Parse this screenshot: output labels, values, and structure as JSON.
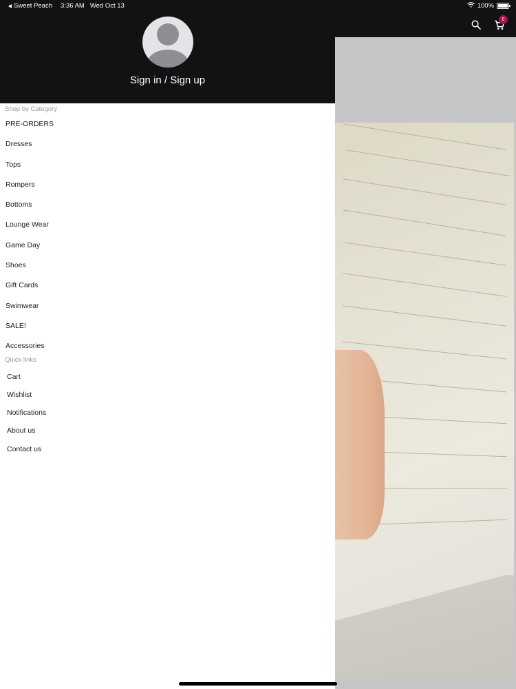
{
  "status_bar": {
    "back_app": "Sweet Peach",
    "time": "3:36 AM",
    "date": "Wed Oct 13",
    "battery": "100%"
  },
  "drawer": {
    "signin": "Sign in / Sign up",
    "shop_by_category": {
      "title": "Shop by Category",
      "items": [
        "PRE-ORDERS",
        "Dresses",
        "Tops",
        "Rompers",
        "Bottoms",
        "Lounge Wear",
        "Game Day",
        "Shoes",
        "Gift Cards",
        "Swimwear",
        "SALE!",
        "Accessories"
      ]
    },
    "quick_links": {
      "title": "Quick links",
      "items": [
        "Cart",
        "Wishlist",
        "Notifications",
        "About us",
        "Contact us"
      ]
    }
  },
  "header": {
    "cart_count": "0",
    "icons": [
      "search-icon",
      "cart-icon"
    ]
  },
  "colors": {
    "header_bg": "#121114",
    "badge": "#a3134a"
  }
}
